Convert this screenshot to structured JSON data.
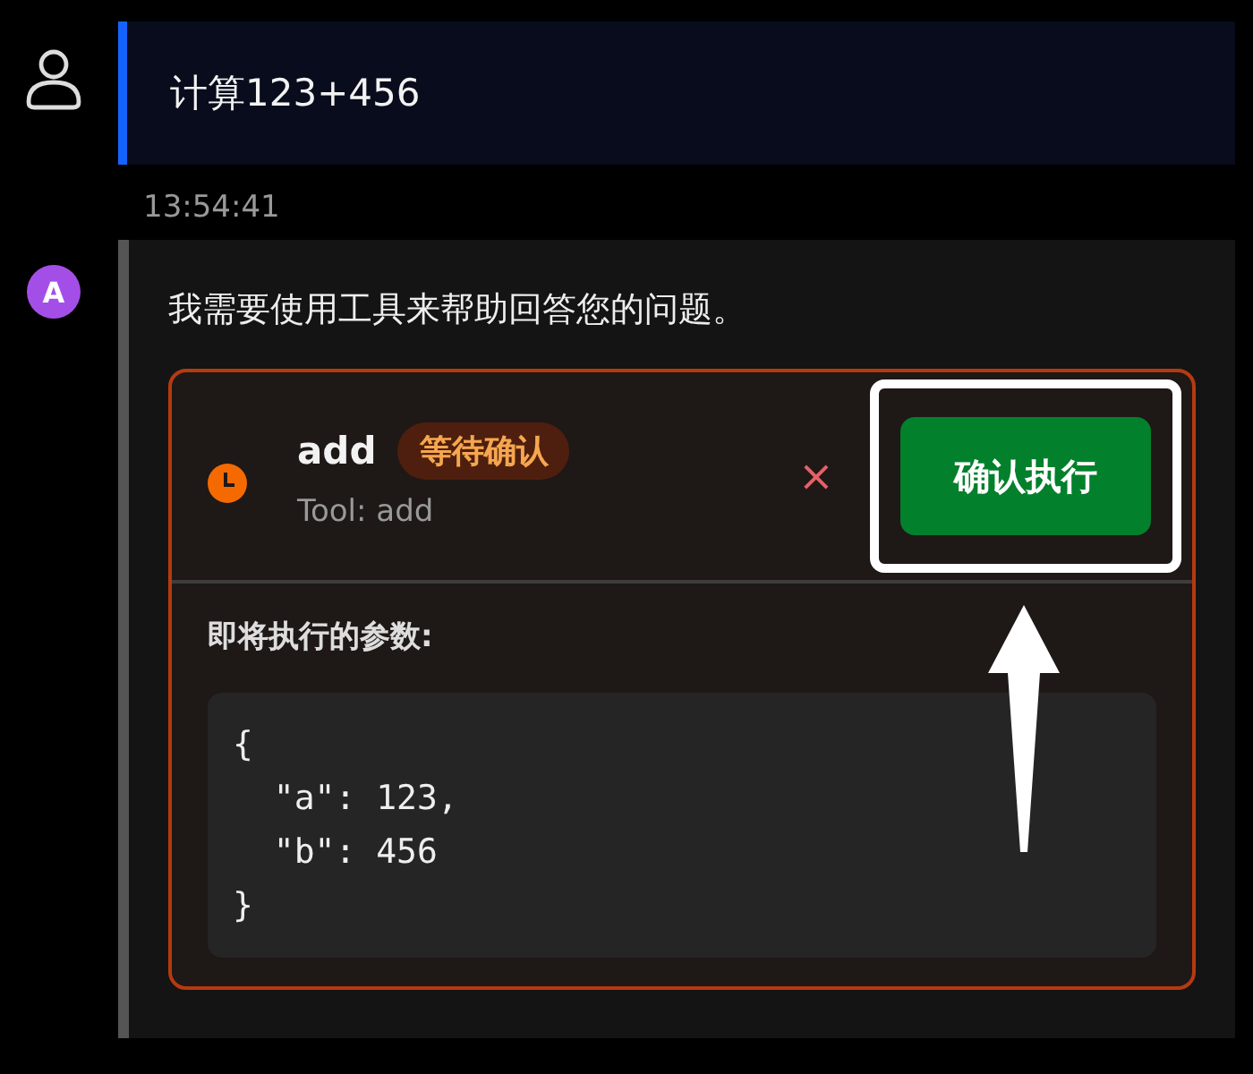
{
  "user_message": {
    "text": "计算123+456",
    "time": "13:54:41"
  },
  "assistant_message": {
    "avatar": "A",
    "text": "我需要使用工具来帮助回答您的问题。",
    "tool_call": {
      "name": "add",
      "status": "等待确认",
      "subtitle": "Tool: add",
      "reject": "×",
      "confirm": "确认执行",
      "params_label": "即将执行的参数:",
      "params": "{\n  \"a\": 123,\n  \"b\": 456\n}"
    }
  }
}
